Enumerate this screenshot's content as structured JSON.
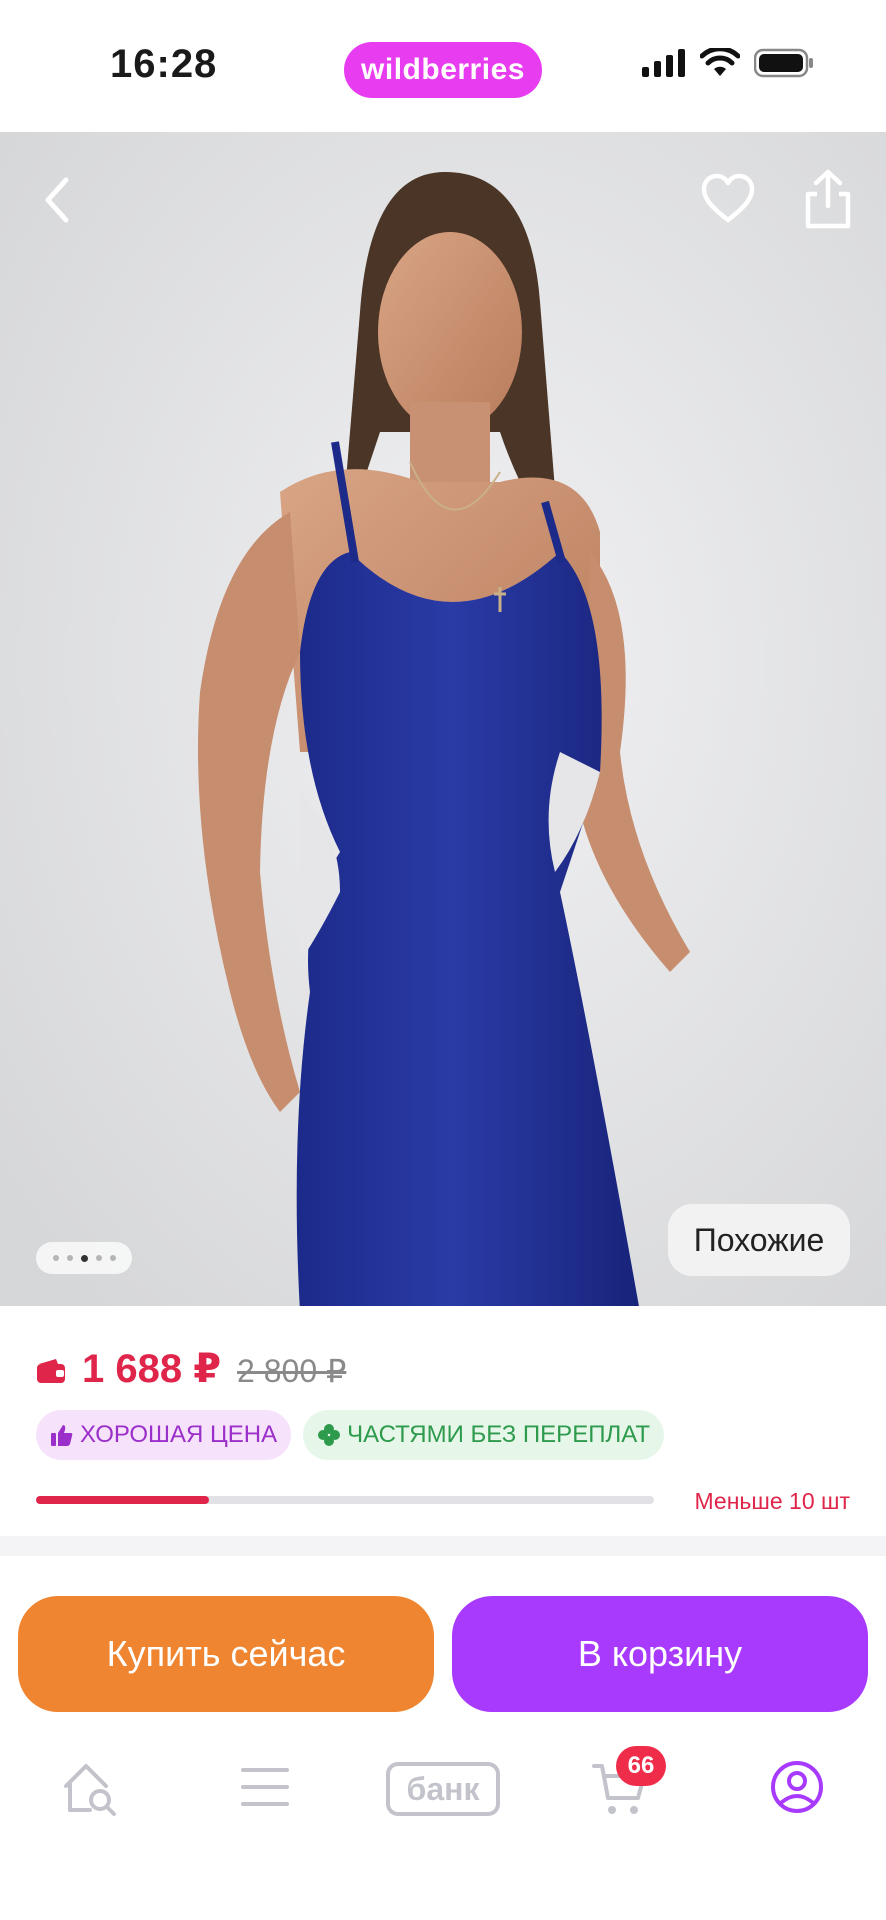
{
  "status_bar": {
    "time": "16:28",
    "app_badge": "wildberries"
  },
  "photo": {
    "similar_label": "Похожие",
    "page_count": 5,
    "current_page": 3
  },
  "price": {
    "current": "1 688 ₽",
    "old": "2 800 ₽",
    "badges": [
      {
        "label": "ХОРОШАЯ ЦЕНА",
        "icon": "thumbs-up-icon"
      },
      {
        "label": "ЧАСТЯМИ БЕЗ ПЕРЕПЛАТ",
        "icon": "clover-icon"
      }
    ],
    "stock_label": "Меньше 10 шт",
    "stock_level": 0.28
  },
  "actions": {
    "buy_now": "Купить сейчас",
    "add_to_cart": "В корзину"
  },
  "tabbar": {
    "bank_label": "банк",
    "cart_count": "66",
    "items": [
      "home-search-icon",
      "menu-icon",
      "bank-icon",
      "cart-icon",
      "profile-icon"
    ]
  },
  "colors": {
    "brand_pink": "#e83cf0",
    "price_red": "#e0254a",
    "buy_orange": "#ef8530",
    "cart_purple": "#a73afd"
  }
}
